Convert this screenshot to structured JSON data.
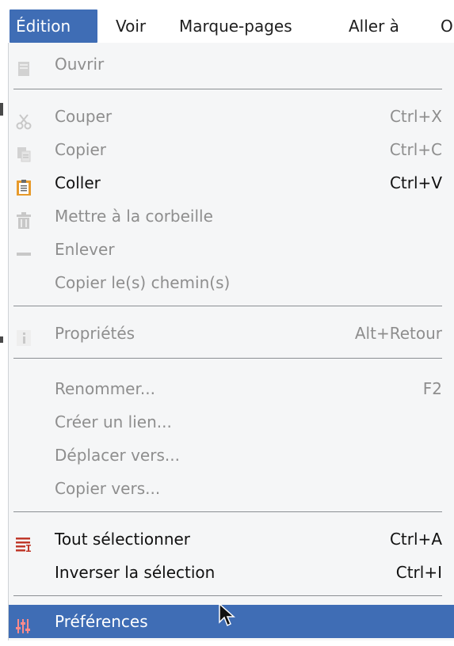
{
  "menubar": {
    "edition": "Édition",
    "voir": "Voir",
    "marque_pages": "Marque-pages",
    "aller_a": "Aller à",
    "overflow": "O"
  },
  "menu": {
    "ouvrir": {
      "label": "Ouvrir",
      "icon": "open-document-icon"
    },
    "couper": {
      "label": "Couper",
      "accel": "Ctrl+X",
      "icon": "scissors-icon"
    },
    "copier": {
      "label": "Copier",
      "accel": "Ctrl+C",
      "icon": "copy-icon"
    },
    "coller": {
      "label": "Coller",
      "accel": "Ctrl+V",
      "icon": "clipboard-icon"
    },
    "corbeille": {
      "label": "Mettre à la corbeille",
      "icon": "trash-icon"
    },
    "enlever": {
      "label": "Enlever",
      "icon": "minus-icon"
    },
    "copier_chemins": {
      "label": "Copier le(s) chemin(s)"
    },
    "proprietes": {
      "label": "Propriétés",
      "accel": "Alt+Retour",
      "icon": "info-icon"
    },
    "renommer": {
      "label": "Renommer...",
      "accel": "F2"
    },
    "creer_lien": {
      "label": "Créer un lien..."
    },
    "deplacer": {
      "label": "Déplacer vers..."
    },
    "copier_vers": {
      "label": "Copier vers..."
    },
    "tout_selectionner": {
      "label": "Tout sélectionner",
      "accel": "Ctrl+A",
      "icon": "select-all-icon"
    },
    "inverser": {
      "label": "Inverser la sélection",
      "accel": "Ctrl+I"
    },
    "preferences": {
      "label": "Préférences",
      "icon": "sliders-icon"
    }
  },
  "colors": {
    "highlight": "#3f6db5",
    "menu_bg": "#f5f6f7",
    "disabled_text": "#8e8e8e"
  }
}
